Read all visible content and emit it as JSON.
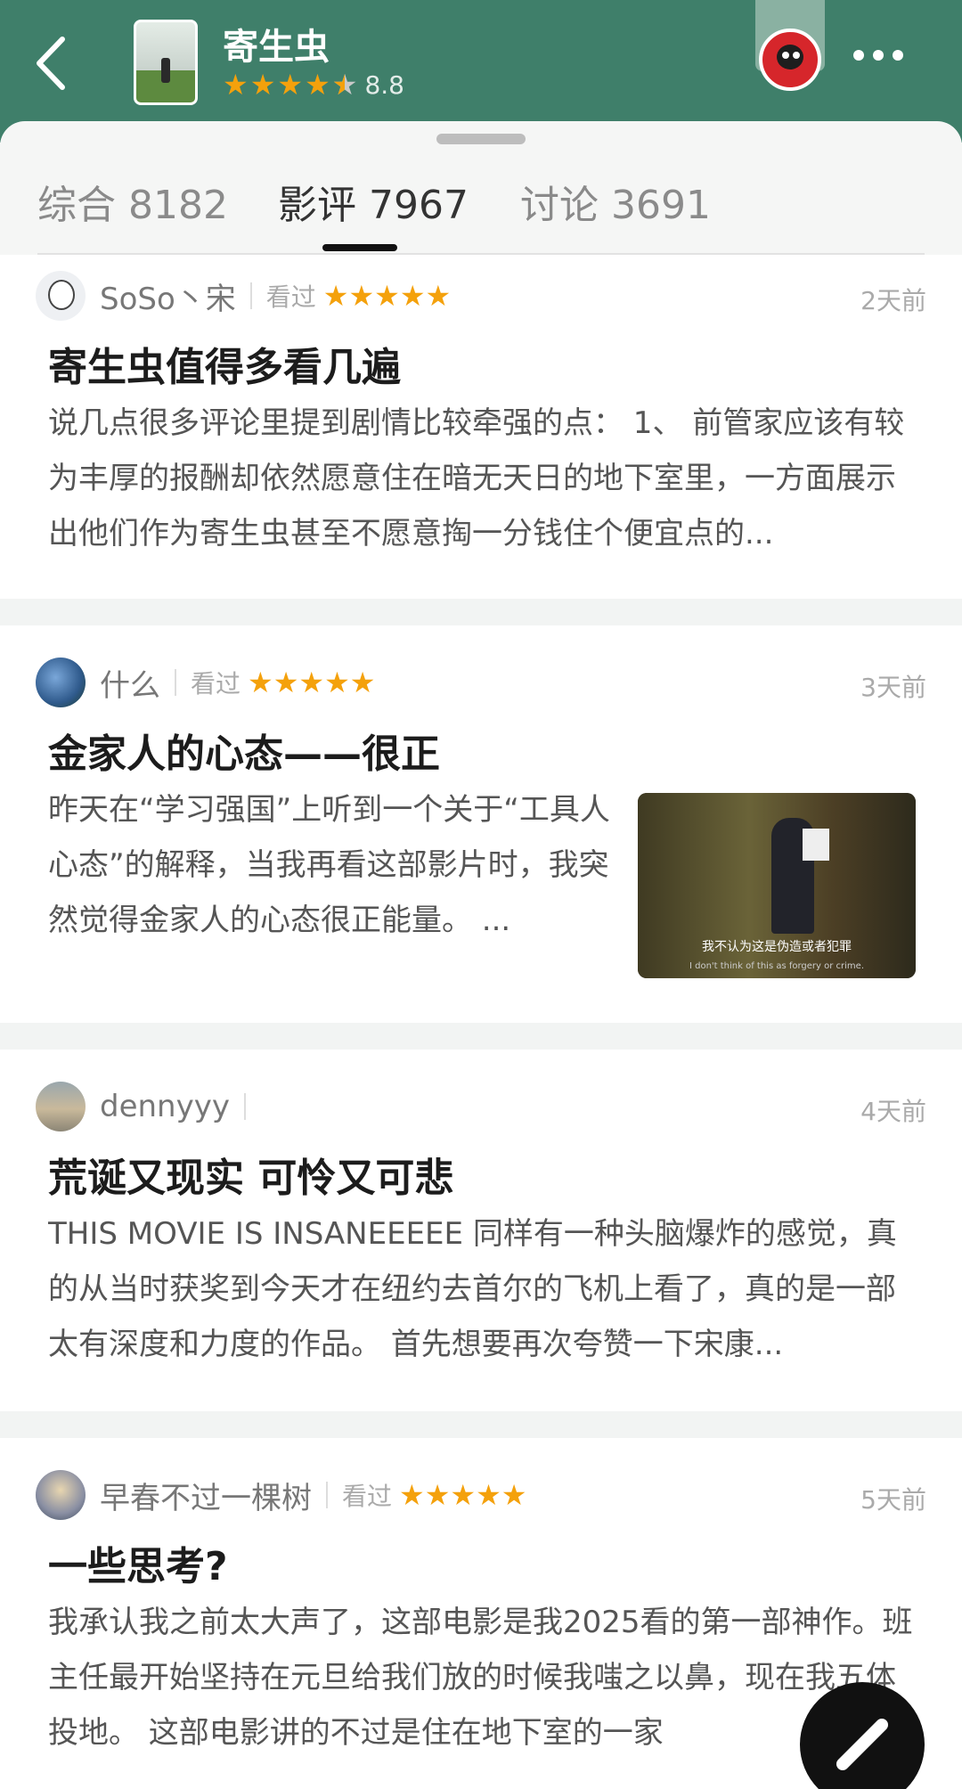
{
  "header": {
    "title": "寄生虫",
    "rating": "8.8",
    "colors": {
      "brand": "#3f7f6a",
      "star": "#f4a10c"
    }
  },
  "tabs": [
    {
      "label": "综合 8182"
    },
    {
      "label": "影评 7967"
    },
    {
      "label": "讨论 3691"
    }
  ],
  "reviews": [
    {
      "user": "SoSo丶宋",
      "status": "看过",
      "stars": "★★★★★",
      "time": "2天前",
      "title": "寄生虫值得多看几遍",
      "body": "说几点很多评论里提到剧情比较牵强的点： 1、 前管家应该有较为丰厚的报酬却依然愿意住在暗无天日的地下室里，一方面展示出他们作为寄生虫甚至不愿意掏一分钱住个便宜点的..."
    },
    {
      "user": "什么",
      "status": "看过",
      "stars": "★★★★★",
      "time": "3天前",
      "title": "金家人的心态——很正",
      "body": "昨天在“学习强国”上听到一个关于“工具人心态”的解释，当我再看这部影片时，我突然觉得金家人的心态很正能量。 ...",
      "thumb_sub_cn": "我不认为这是伪造或者犯罪",
      "thumb_sub_en": "I don't think of this as forgery or crime."
    },
    {
      "user": "dennyyy",
      "time": "4天前",
      "title": "荒诞又现实 可怜又可悲",
      "body": "THIS MOVIE IS INSANEEEEE 同样有一种头脑爆炸的感觉，真的从当时获奖到今天才在纽约去首尔的飞机上看了，真的是一部太有深度和力度的作品。 首先想要再次夸赞一下宋康..."
    },
    {
      "user": "早春不过一棵树",
      "status": "看过",
      "stars": "★★★★★",
      "time": "5天前",
      "title": "一些思考?",
      "body": "我承认我之前太大声了，这部电影是我2025看的第一部神作。班主任最开始坚持在元旦给我们放的时候我嗤之以鼻，现在我五体投地。 这部电影讲的不过是住在地下室的一家"
    }
  ]
}
